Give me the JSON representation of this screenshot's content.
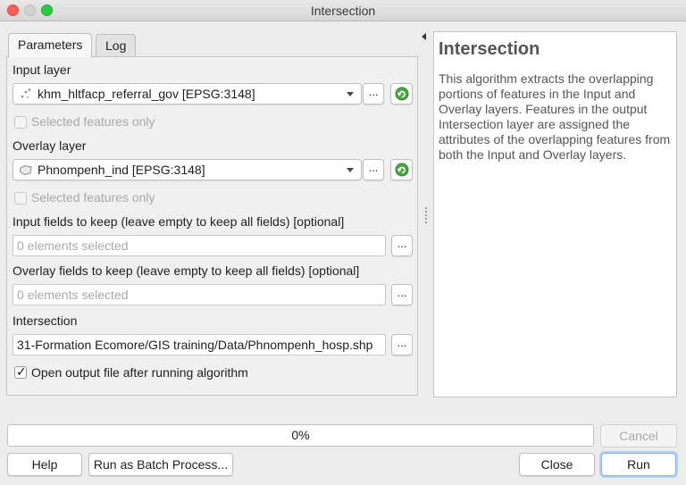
{
  "window": {
    "title": "Intersection"
  },
  "tabs": [
    {
      "label": "Parameters",
      "active": true
    },
    {
      "label": "Log",
      "active": false
    }
  ],
  "params": {
    "input_layer_label": "Input layer",
    "input_layer_value": "khm_hltfacp_referral_gov [EPSG:3148]",
    "input_selected_only": "Selected features only",
    "overlay_layer_label": "Overlay layer",
    "overlay_layer_value": "Phnompenh_ind [EPSG:3148]",
    "overlay_selected_only": "Selected features only",
    "input_fields_label": "Input fields to keep (leave empty to keep all fields) [optional]",
    "input_fields_placeholder": "0 elements selected",
    "overlay_fields_label": "Overlay fields to keep (leave empty to keep all fields) [optional]",
    "overlay_fields_placeholder": "0 elements selected",
    "output_label": "Intersection",
    "output_value": "31-Formation Ecomore/GIS training/Data/Phnompenh_hosp.shp",
    "open_output_label": "Open output file after running algorithm",
    "ellipsis": "...",
    "checkmark": "✓"
  },
  "help": {
    "title": "Intersection",
    "body": "This algorithm extracts the overlapping portions of features in the Input and Overlay layers. Features in the output Intersection layer are assigned the attributes of the overlapping features from both the Input and Overlay layers."
  },
  "progress": {
    "label": "0%",
    "value": 0
  },
  "buttons": {
    "cancel": "Cancel",
    "help": "Help",
    "batch": "Run as Batch Process...",
    "close": "Close",
    "run": "Run"
  },
  "colors": {
    "iterate_icon": "#3f9e3a",
    "default_button_glow": "#b3d1f5"
  },
  "icons": {
    "input_layer": "point-layer-icon",
    "overlay_layer": "polygon-layer-icon",
    "iterate": "iterate-icon"
  }
}
